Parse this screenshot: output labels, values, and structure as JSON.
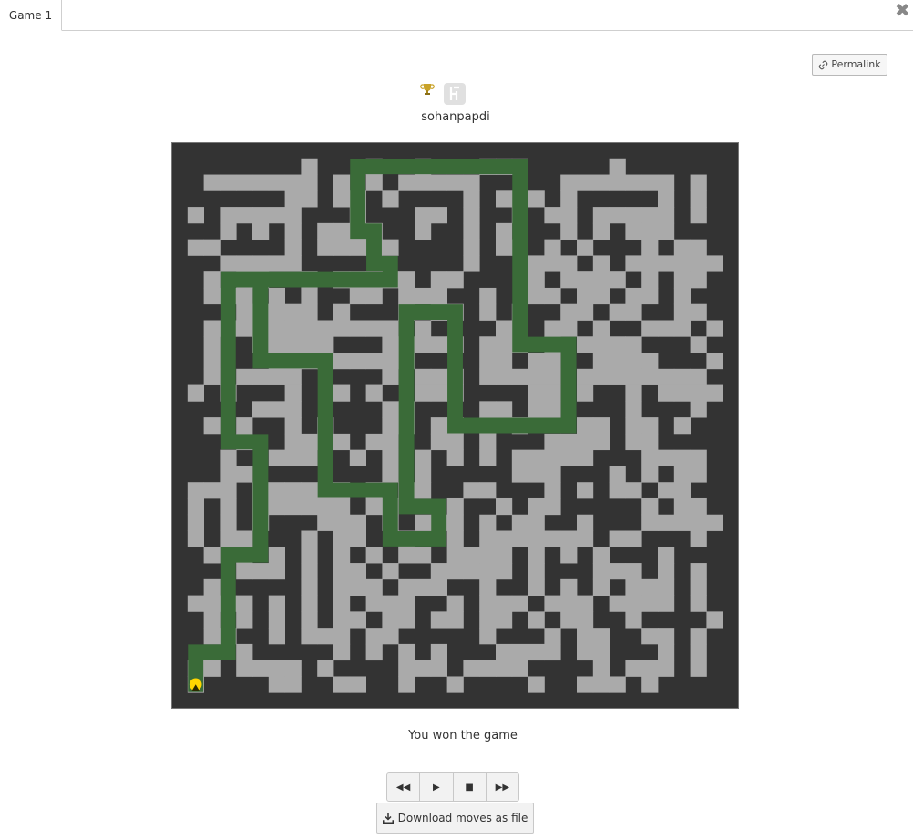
{
  "tab": {
    "label": "Game 1"
  },
  "header": {
    "permalink_label": "Permalink"
  },
  "player": {
    "username": "sohanpapdi"
  },
  "game": {
    "status": "You won the game"
  },
  "controls": {
    "rewind": "◀◀",
    "play": "▶",
    "stop": "■",
    "forward": "▶▶"
  },
  "download": {
    "label": "Download moves as file"
  },
  "colors": {
    "wall": "#aaaaaa",
    "floor": "#333333",
    "path": "#3a6b38",
    "player": "#ffd700",
    "trophy": "#c9a227"
  },
  "maze": {
    "size": 35,
    "rows": [
      "11111111111111111111111111111111111",
      "10000000100010010001110000010000001",
      "10111111101010111110000011111110101",
      "10000001101101000010111010000010101",
      "11011111000100011010010110111110101",
      "10010101011110010010100010101110001",
      "11100001011111000010110101000101101",
      "10011111000000000010001110101111111",
      "10101100101111101100001011110101101",
      "10111010100110111001001101101101001",
      "10001111101000101101010011011001101",
      "10111111111111010000110110100111011",
      "10100111110001111101110101111000101",
      "10100011111111100001101100111100011",
      "10101111000001011101111101111111101",
      "11010001001010011100001101001011111",
      "10000111000001100001101100001000101",
      "10101001010001101101010001101101001",
      "10001001111011001101000111101100001",
      "10010011100101010101011111000111101",
      "10011000000001010000011100010101101",
      "11110111111010110011000101011011001",
      "11010111111011000100101100000101101",
      "11010100011101011101011001000111111",
      "11011000101100100101111111011000101",
      "10101010101010110111101010100010001",
      "10001110101101001111101000111010101",
      "10100000101110111001001010101110101",
      "11111010101011100101110111011110101",
      "10101010101101101101101011001000011",
      "10110010111011000001000101100110101",
      "10001000001010101000111101100010101",
      "11101111010000111011110000101110101",
      "11000011001100100100001001110100001",
      "11111111111111111111111111111111111"
    ],
    "path": [
      [
        33,
        1
      ],
      [
        32,
        1
      ],
      [
        31,
        1
      ],
      [
        31,
        2
      ],
      [
        31,
        3
      ],
      [
        30,
        3
      ],
      [
        29,
        3
      ],
      [
        28,
        3
      ],
      [
        27,
        3
      ],
      [
        26,
        3
      ],
      [
        25,
        3
      ],
      [
        25,
        4
      ],
      [
        25,
        5
      ],
      [
        24,
        5
      ],
      [
        23,
        5
      ],
      [
        22,
        5
      ],
      [
        21,
        5
      ],
      [
        20,
        5
      ],
      [
        19,
        5
      ],
      [
        18,
        5
      ],
      [
        18,
        4
      ],
      [
        18,
        3
      ],
      [
        17,
        3
      ],
      [
        16,
        3
      ],
      [
        15,
        3
      ],
      [
        14,
        3
      ],
      [
        13,
        3
      ],
      [
        12,
        3
      ],
      [
        11,
        3
      ],
      [
        10,
        3
      ],
      [
        9,
        3
      ],
      [
        8,
        3
      ],
      [
        8,
        4
      ],
      [
        8,
        5
      ],
      [
        8,
        6
      ],
      [
        8,
        7
      ],
      [
        8,
        8
      ],
      [
        8,
        9
      ],
      [
        8,
        10
      ],
      [
        8,
        11
      ],
      [
        8,
        12
      ],
      [
        8,
        13
      ],
      [
        7,
        13
      ],
      [
        7,
        12
      ],
      [
        6,
        12
      ],
      [
        5,
        12
      ],
      [
        5,
        11
      ],
      [
        4,
        11
      ],
      [
        3,
        11
      ],
      [
        2,
        11
      ],
      [
        1,
        11
      ],
      [
        1,
        12
      ],
      [
        1,
        13
      ],
      [
        1,
        14
      ],
      [
        1,
        15
      ],
      [
        1,
        16
      ],
      [
        1,
        17
      ],
      [
        1,
        18
      ],
      [
        1,
        19
      ],
      [
        1,
        20
      ],
      [
        1,
        21
      ],
      [
        2,
        21
      ],
      [
        3,
        21
      ],
      [
        4,
        21
      ],
      [
        5,
        21
      ],
      [
        6,
        21
      ],
      [
        7,
        21
      ],
      [
        8,
        21
      ],
      [
        9,
        21
      ],
      [
        10,
        21
      ],
      [
        11,
        21
      ],
      [
        12,
        21
      ],
      [
        12,
        22
      ],
      [
        12,
        23
      ],
      [
        12,
        24
      ],
      [
        13,
        24
      ],
      [
        14,
        24
      ],
      [
        15,
        24
      ],
      [
        16,
        24
      ],
      [
        17,
        24
      ],
      [
        17,
        23
      ],
      [
        17,
        22
      ],
      [
        17,
        21
      ],
      [
        17,
        20
      ],
      [
        17,
        19
      ],
      [
        17,
        18
      ],
      [
        17,
        17
      ],
      [
        16,
        17
      ],
      [
        15,
        17
      ],
      [
        14,
        17
      ],
      [
        13,
        17
      ],
      [
        12,
        17
      ],
      [
        11,
        17
      ],
      [
        10,
        17
      ],
      [
        10,
        16
      ],
      [
        10,
        15
      ],
      [
        10,
        14
      ],
      [
        11,
        14
      ],
      [
        12,
        14
      ],
      [
        13,
        14
      ],
      [
        14,
        14
      ],
      [
        15,
        14
      ],
      [
        16,
        14
      ],
      [
        17,
        14
      ],
      [
        18,
        14
      ],
      [
        19,
        14
      ],
      [
        20,
        14
      ],
      [
        21,
        14
      ],
      [
        22,
        14
      ],
      [
        22,
        15
      ],
      [
        22,
        16
      ],
      [
        23,
        16
      ],
      [
        24,
        16
      ],
      [
        24,
        15
      ],
      [
        24,
        14
      ],
      [
        24,
        13
      ],
      [
        23,
        13
      ],
      [
        22,
        13
      ],
      [
        21,
        13
      ],
      [
        21,
        12
      ],
      [
        21,
        11
      ],
      [
        21,
        10
      ],
      [
        21,
        9
      ],
      [
        20,
        9
      ],
      [
        19,
        9
      ],
      [
        18,
        9
      ],
      [
        17,
        9
      ],
      [
        16,
        9
      ],
      [
        15,
        9
      ],
      [
        14,
        9
      ],
      [
        13,
        9
      ],
      [
        13,
        8
      ],
      [
        13,
        7
      ],
      [
        13,
        6
      ],
      [
        13,
        5
      ],
      [
        12,
        5
      ],
      [
        11,
        5
      ],
      [
        10,
        5
      ],
      [
        9,
        5
      ],
      [
        8,
        5
      ]
    ]
  }
}
